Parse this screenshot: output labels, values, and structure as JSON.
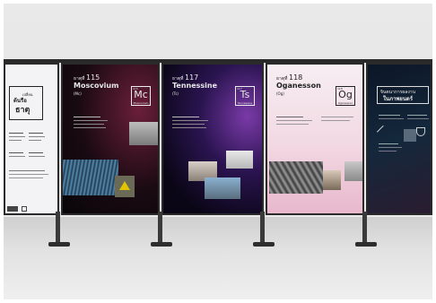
{
  "panels": [
    {
      "id": "intro",
      "heading_line1": "เปลี่ยน",
      "heading_line2": "ต้นรือ",
      "heading_line3": "ธาตุ"
    },
    {
      "id": "moscovium",
      "label": "ธาตุที่",
      "number": "115",
      "name": "Moscovium",
      "symbol_paren": "(Mc)",
      "symbol": "Mc",
      "symbol_number": "115",
      "symbol_label": "Moscovium"
    },
    {
      "id": "tennessine",
      "label": "ธาตุที่",
      "number": "117",
      "name": "Tennessine",
      "symbol_paren": "(Ts)",
      "symbol": "Ts",
      "symbol_number": "117",
      "symbol_label": "Tennessine"
    },
    {
      "id": "oganesson",
      "label": "ธาตุที่",
      "number": "118",
      "name": "Oganesson",
      "symbol_paren": "(Og)",
      "symbol": "Og",
      "symbol_number": "118",
      "symbol_label": "Oganesson"
    },
    {
      "id": "closing",
      "heading_line1": "จินตนาการผลงาน",
      "heading_line2": "ในภาพยนตร์"
    }
  ],
  "colors": {
    "rail": "#2a2a2a",
    "accent_pink": "#e8b8cc",
    "accent_purple": "#7a3aa8"
  }
}
